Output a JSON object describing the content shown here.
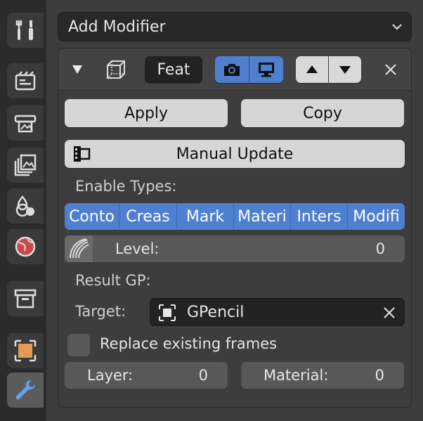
{
  "add_modifier": {
    "label": "Add Modifier"
  },
  "modifier": {
    "name": "Feat",
    "apply_label": "Apply",
    "copy_label": "Copy",
    "manual_update_label": "Manual Update",
    "enable_types_label": "Enable Types:",
    "enable_types": [
      "Conto",
      "Creas",
      "Mark",
      "Materi",
      "Inters",
      "Modifi"
    ],
    "level_label": "Level:",
    "level_value": "0",
    "result_gp_label": "Result GP:",
    "target_label": "Target:",
    "target_value": "GPencil",
    "replace_frames_label": "Replace existing frames",
    "replace_frames_checked": false,
    "layer_label": "Layer:",
    "layer_value": "0",
    "material_label": "Material:",
    "material_value": "0"
  },
  "colors": {
    "accent": "#4f7fcf",
    "panel": "#3d3d3d",
    "field": "#585858"
  },
  "tabs": [
    "tool-icon",
    "render-icon",
    "output-icon",
    "view-layer-icon",
    "scene-icon",
    "world-icon",
    "collection-icon",
    "object-icon",
    "modifier-icon"
  ]
}
